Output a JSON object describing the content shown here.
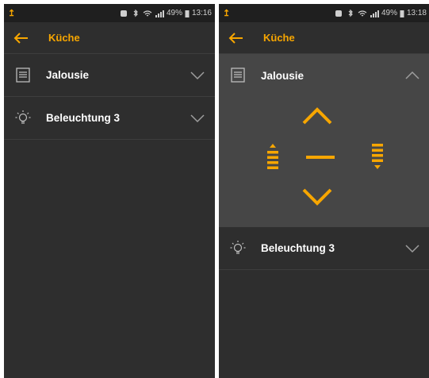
{
  "accent_color": "#f7a600",
  "screens": [
    {
      "status": {
        "battery_percent": "49%",
        "time": "13:16"
      },
      "appbar": {
        "title": "Küche"
      },
      "rows": [
        {
          "label": "Jalousie",
          "icon": "blind-icon",
          "chevron": "chevron-down-icon"
        },
        {
          "label": "Beleuchtung 3",
          "icon": "lightbulb-icon",
          "chevron": "chevron-down-icon"
        }
      ]
    },
    {
      "status": {
        "battery_percent": "49%",
        "time": "13:18"
      },
      "appbar": {
        "title": "Küche"
      },
      "rows": [
        {
          "label": "Jalousie",
          "icon": "blind-icon",
          "chevron": "chevron-up-icon",
          "expanded": true
        },
        {
          "label": "Beleuchtung 3",
          "icon": "lightbulb-icon",
          "chevron": "chevron-down-icon"
        }
      ],
      "blind_controls": [
        "move-up-button",
        "stop-button",
        "move-down-button",
        "step-up-button",
        "step-down-button"
      ]
    }
  ]
}
